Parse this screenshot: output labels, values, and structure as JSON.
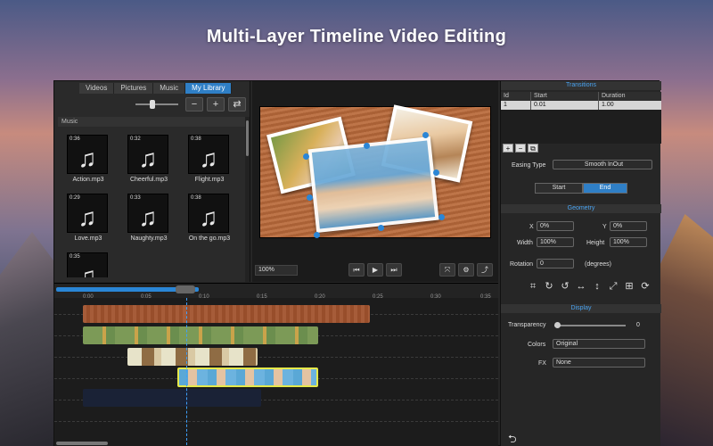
{
  "headline": "Multi-Layer Timeline Video Editing",
  "library": {
    "tabs": [
      "Videos",
      "Pictures",
      "Music",
      "My Library"
    ],
    "active_tab": "My Library",
    "section": "Music",
    "items": [
      {
        "duration": "0:36",
        "name": "Action.mp3"
      },
      {
        "duration": "0:32",
        "name": "Cheerful.mp3"
      },
      {
        "duration": "0:38",
        "name": "Flight.mp3"
      },
      {
        "duration": "0:29",
        "name": "Love.mp3"
      },
      {
        "duration": "0:33",
        "name": "Naughty.mp3"
      },
      {
        "duration": "0:38",
        "name": "On the go.mp3"
      },
      {
        "duration": "0:35",
        "name": ""
      }
    ],
    "tools": [
      "−",
      "+",
      "⇄"
    ]
  },
  "preview": {
    "zoom": "100%",
    "buttons": [
      "⏮",
      "▶",
      "⏭",
      "⤧",
      "⚙",
      "⤴"
    ]
  },
  "timeline": {
    "ticks": [
      "0:00",
      "0:05",
      "0:10",
      "0:15",
      "0:20",
      "0:25",
      "0:30",
      "0:35"
    ]
  },
  "transitions": {
    "title": "Transitions",
    "columns": [
      "Id",
      "Start",
      "Duration"
    ],
    "rows": [
      {
        "id": "1",
        "start": "0.01",
        "duration": "1.00"
      }
    ],
    "mini_buttons": [
      "+",
      "−",
      "⧉"
    ],
    "easing_label": "Easing Type",
    "easing_value": "Smooth InOut",
    "start_label": "Start",
    "end_label": "End"
  },
  "geometry": {
    "title": "Geometry",
    "x_label": "X",
    "x_value": "0%",
    "y_label": "Y",
    "y_value": "0%",
    "width_label": "Width",
    "width_value": "100%",
    "height_label": "Height",
    "height_value": "100%",
    "rotation_label": "Rotation",
    "rotation_value": "0",
    "rotation_unit": "(degrees)",
    "icons": [
      "⌗",
      "↻",
      "↺",
      "↔",
      "↕",
      "⤢",
      "⊞",
      "⟳"
    ]
  },
  "display": {
    "title": "Display",
    "transparency_label": "Transparency",
    "transparency_value": "0",
    "colors_label": "Colors",
    "colors_value": "Original",
    "fx_label": "FX",
    "fx_value": "None"
  },
  "undo": "⮌",
  "colors": {
    "accent": "#2f7fc6"
  }
}
